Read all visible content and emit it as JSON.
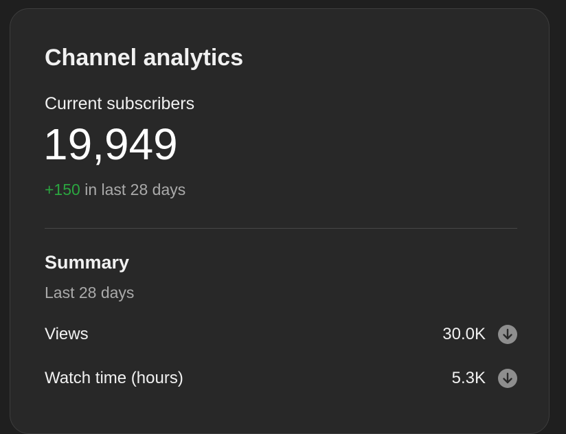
{
  "card": {
    "title": "Channel analytics",
    "subscribers": {
      "label": "Current subscribers",
      "count": "19,949",
      "change": "+150",
      "period": " in last 28 days"
    },
    "summary": {
      "title": "Summary",
      "period": "Last 28 days",
      "metrics": [
        {
          "label": "Views",
          "value": "30.0K",
          "trend_icon": "arrow-down-icon"
        },
        {
          "label": "Watch time (hours)",
          "value": "5.3K",
          "trend_icon": "arrow-down-icon"
        }
      ]
    }
  },
  "colors": {
    "background": "#1f1f1f",
    "card": "#282828",
    "positive": "#2ba640",
    "secondary_text": "#aaaaaa",
    "icon_circle": "#8e8e8e"
  }
}
